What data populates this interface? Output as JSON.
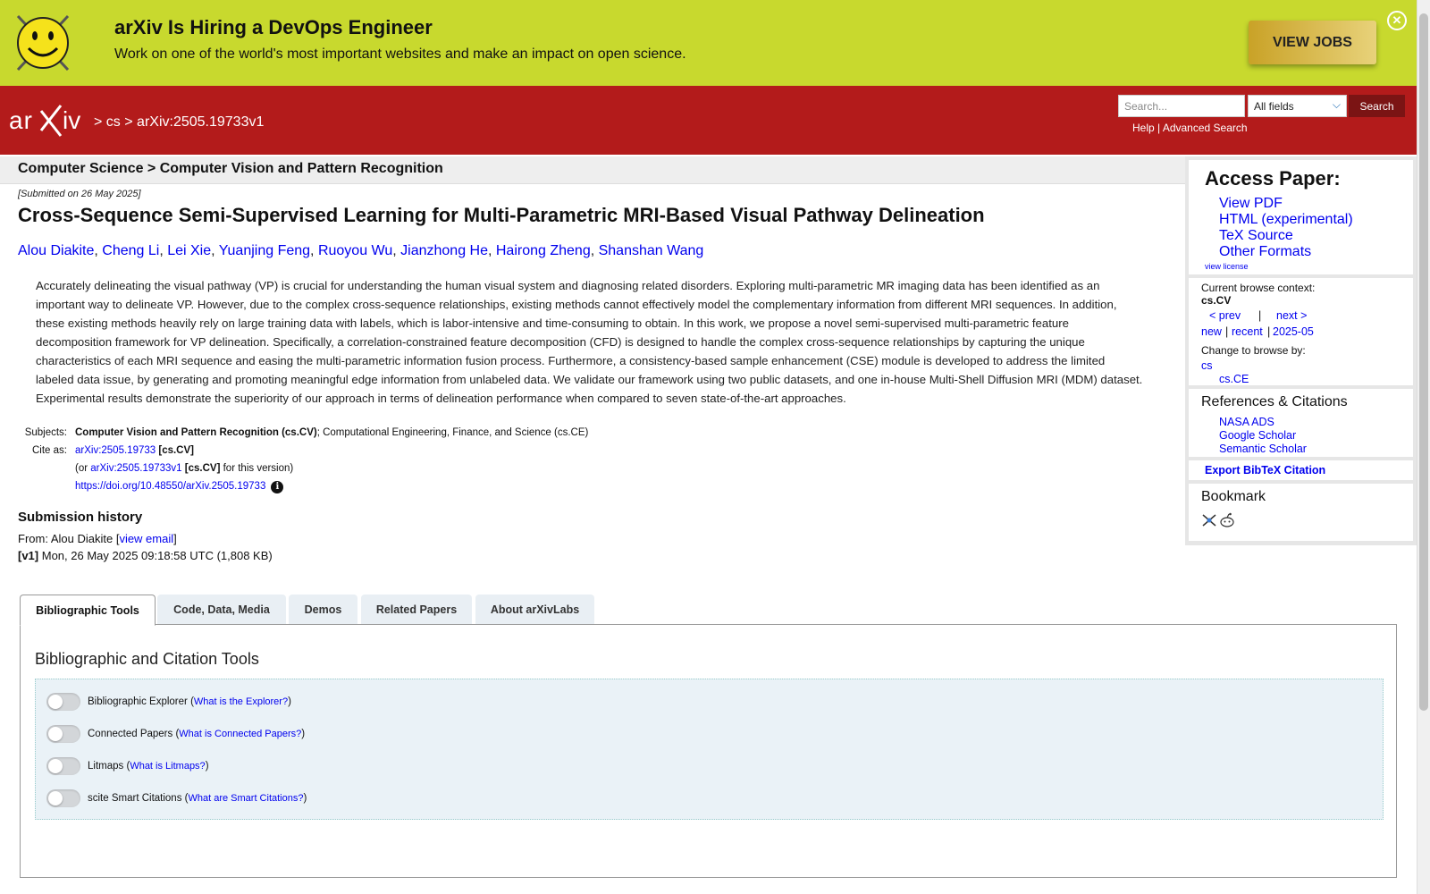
{
  "banner": {
    "title": "arXiv Is Hiring a DevOps Engineer",
    "text": "Work on one of the world's most important websites and make an impact on open science.",
    "button": "VIEW JOBS",
    "close": "✕"
  },
  "header": {
    "logo_text": "arXiv",
    "breadcrumb": {
      "sep1": ">",
      "category": "cs",
      "sep2": ">",
      "paper_id": "arXiv:2505.19733v1"
    },
    "search": {
      "placeholder": "Search...",
      "field": "All fields",
      "button": "Search"
    },
    "help": "Help",
    "help_sep": "|",
    "advanced": "Advanced Search"
  },
  "subheader": "Computer Science > Computer Vision and Pattern Recognition",
  "paper": {
    "submitted": "[Submitted on 26 May 2025]",
    "title": "Cross-Sequence Semi-Supervised Learning for Multi-Parametric MRI-Based Visual Pathway Delineation",
    "authors": [
      "Alou Diakite",
      "Cheng Li",
      "Lei Xie",
      "Yuanjing Feng",
      "Ruoyou Wu",
      "Jianzhong He",
      "Hairong Zheng",
      "Shanshan Wang"
    ],
    "abstract": "Accurately delineating the visual pathway (VP) is crucial for understanding the human visual system and diagnosing related disorders. Exploring multi-parametric MR imaging data has been identified as an important way to delineate VP. However, due to the complex cross-sequence relationships, existing methods cannot effectively model the complementary information from different MRI sequences. In addition, these existing methods heavily rely on large training data with labels, which is labor-intensive and time-consuming to obtain. In this work, we propose a novel semi-supervised multi-parametric feature decomposition framework for VP delineation. Specifically, a correlation-constrained feature decomposition (CFD) is designed to handle the complex cross-sequence relationships by capturing the unique characteristics of each MRI sequence and easing the multi-parametric information fusion process. Furthermore, a consistency-based sample enhancement (CSE) module is developed to address the limited labeled data issue, by generating and promoting meaningful edge information from unlabeled data. We validate our framework using two public datasets, and one in-house Multi-Shell Diffusion MRI (MDM) dataset. Experimental results demonstrate the superiority of our approach in terms of delineation performance when compared to seven state-of-the-art approaches.",
    "subjects_label": "Subjects:",
    "subjects_primary": "Computer Vision and Pattern Recognition (cs.CV)",
    "subjects_rest": "; Computational Engineering, Finance, and Science (cs.CE)",
    "cite_label": "Cite as:",
    "cite_id": "arXiv:2505.19733",
    "cite_cat": "[cs.CV]",
    "cite_or_pre": "(or",
    "cite_version_id": "arXiv:2505.19733v1",
    "cite_version_cat": "[cs.CV]",
    "cite_version_post": "for this version)",
    "doi": "https://doi.org/10.48550/arXiv.2505.19733",
    "info_icon": "i"
  },
  "history": {
    "title": "Submission history",
    "from_pre": "From: Alou Diakite [",
    "view_email": "view email",
    "from_post": "]",
    "v1_label": "[v1]",
    "v1_text": "Mon, 26 May 2025 09:18:58 UTC (1,808 KB)"
  },
  "sidebar": {
    "access_title": "Access Paper:",
    "links": [
      "View PDF",
      "HTML (experimental)",
      "TeX Source",
      "Other Formats"
    ],
    "view_license": "view license",
    "context_label": "Current browse context:",
    "context_value": "cs.CV",
    "prev": "< prev",
    "pipe": "|",
    "next": "next >",
    "new": "new",
    "recent": "recent",
    "month": "2025-05",
    "change_label": "Change to browse by:",
    "browse_cs": "cs",
    "browse_csce": "cs.CE",
    "refs_title": "References & Citations",
    "refs": [
      "NASA ADS",
      "Google Scholar",
      "Semantic Scholar"
    ],
    "export": "Export BibTeX Citation",
    "bookmark_title": "Bookmark"
  },
  "tabs": [
    "Bibliographic Tools",
    "Code, Data, Media",
    "Demos",
    "Related Papers",
    "About arXivLabs"
  ],
  "tools": {
    "title": "Bibliographic and Citation Tools",
    "items": [
      {
        "label": "Bibliographic Explorer",
        "link": "What is the Explorer?"
      },
      {
        "label": "Connected Papers",
        "link": "What is Connected Papers?"
      },
      {
        "label": "Litmaps",
        "link": "What is Litmaps?"
      },
      {
        "label": "scite Smart Citations",
        "link": "What are Smart Citations?"
      }
    ]
  },
  "colors": {
    "brand_red": "#b31b1b",
    "banner_green": "#c8d92e",
    "link_blue": "#0000ee"
  }
}
